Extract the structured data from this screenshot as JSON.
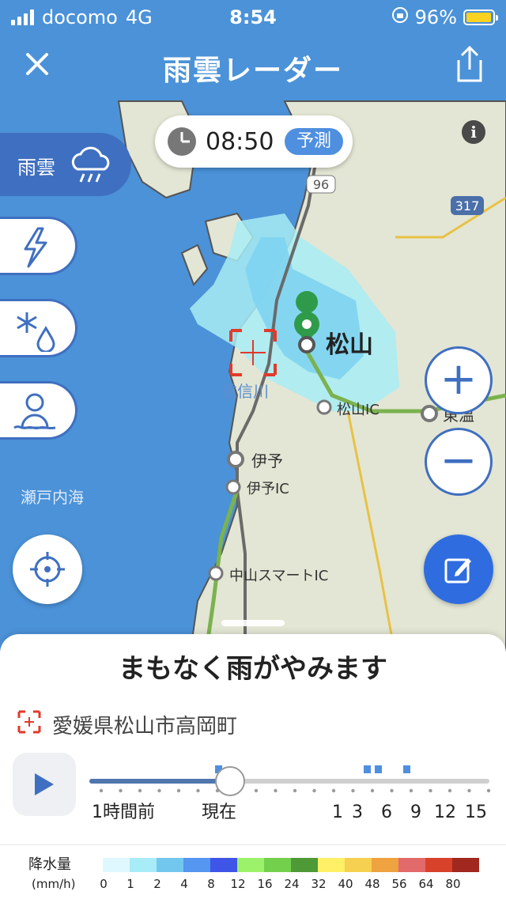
{
  "status_bar": {
    "carrier": "docomo",
    "network": "4G",
    "time": "8:54",
    "battery": "96%",
    "battery_level": 0.96
  },
  "header": {
    "title": "雨雲レーダー",
    "close_icon": "close-icon",
    "share_icon": "share-icon"
  },
  "map": {
    "time": "08:50",
    "mode_badge": "予測",
    "labels": {
      "city": "松山",
      "river": "重信川",
      "sea": "瀬戸内海",
      "iyo": "伊予",
      "iyo_ic": "伊予IC",
      "matsuyama_ic": "松山IC",
      "toon": "東温",
      "nakayama_ic": "中山スマートIC",
      "route_96": "96",
      "route_317": "317"
    },
    "info_label": "i",
    "colors": {
      "sea": "#4b92d8",
      "land": "#e3e6d4",
      "rain_light": "#a8ecf5",
      "rain_mid": "#7fd4ef"
    }
  },
  "layers": {
    "active_label": "雨雲",
    "items": [
      "lightning-icon",
      "snow-icon",
      "snowman-icon"
    ]
  },
  "controls": {
    "zoom_in": "+",
    "zoom_out": "−"
  },
  "sheet": {
    "headline": "まもなく雨がやみます",
    "address": "愛媛県松山市高岡町",
    "timeline": {
      "labels": [
        "1時間前",
        "現在",
        "1",
        "3",
        "6",
        "9",
        "12",
        "15"
      ],
      "progress": 0.35
    }
  },
  "legend": {
    "title": "降水量",
    "unit": "(mm/h)",
    "ticks": [
      "0",
      "1",
      "2",
      "4",
      "8",
      "12",
      "16",
      "24",
      "32",
      "40",
      "48",
      "56",
      "64",
      "80"
    ],
    "colors": [
      "#dff8ff",
      "#a8ecf7",
      "#72c7ee",
      "#5596f0",
      "#3f55e8",
      "#9cf26a",
      "#73d04c",
      "#4d9a36",
      "#fff067",
      "#f6d050",
      "#eea240",
      "#e36a6a",
      "#d8422a",
      "#a0281e"
    ]
  }
}
